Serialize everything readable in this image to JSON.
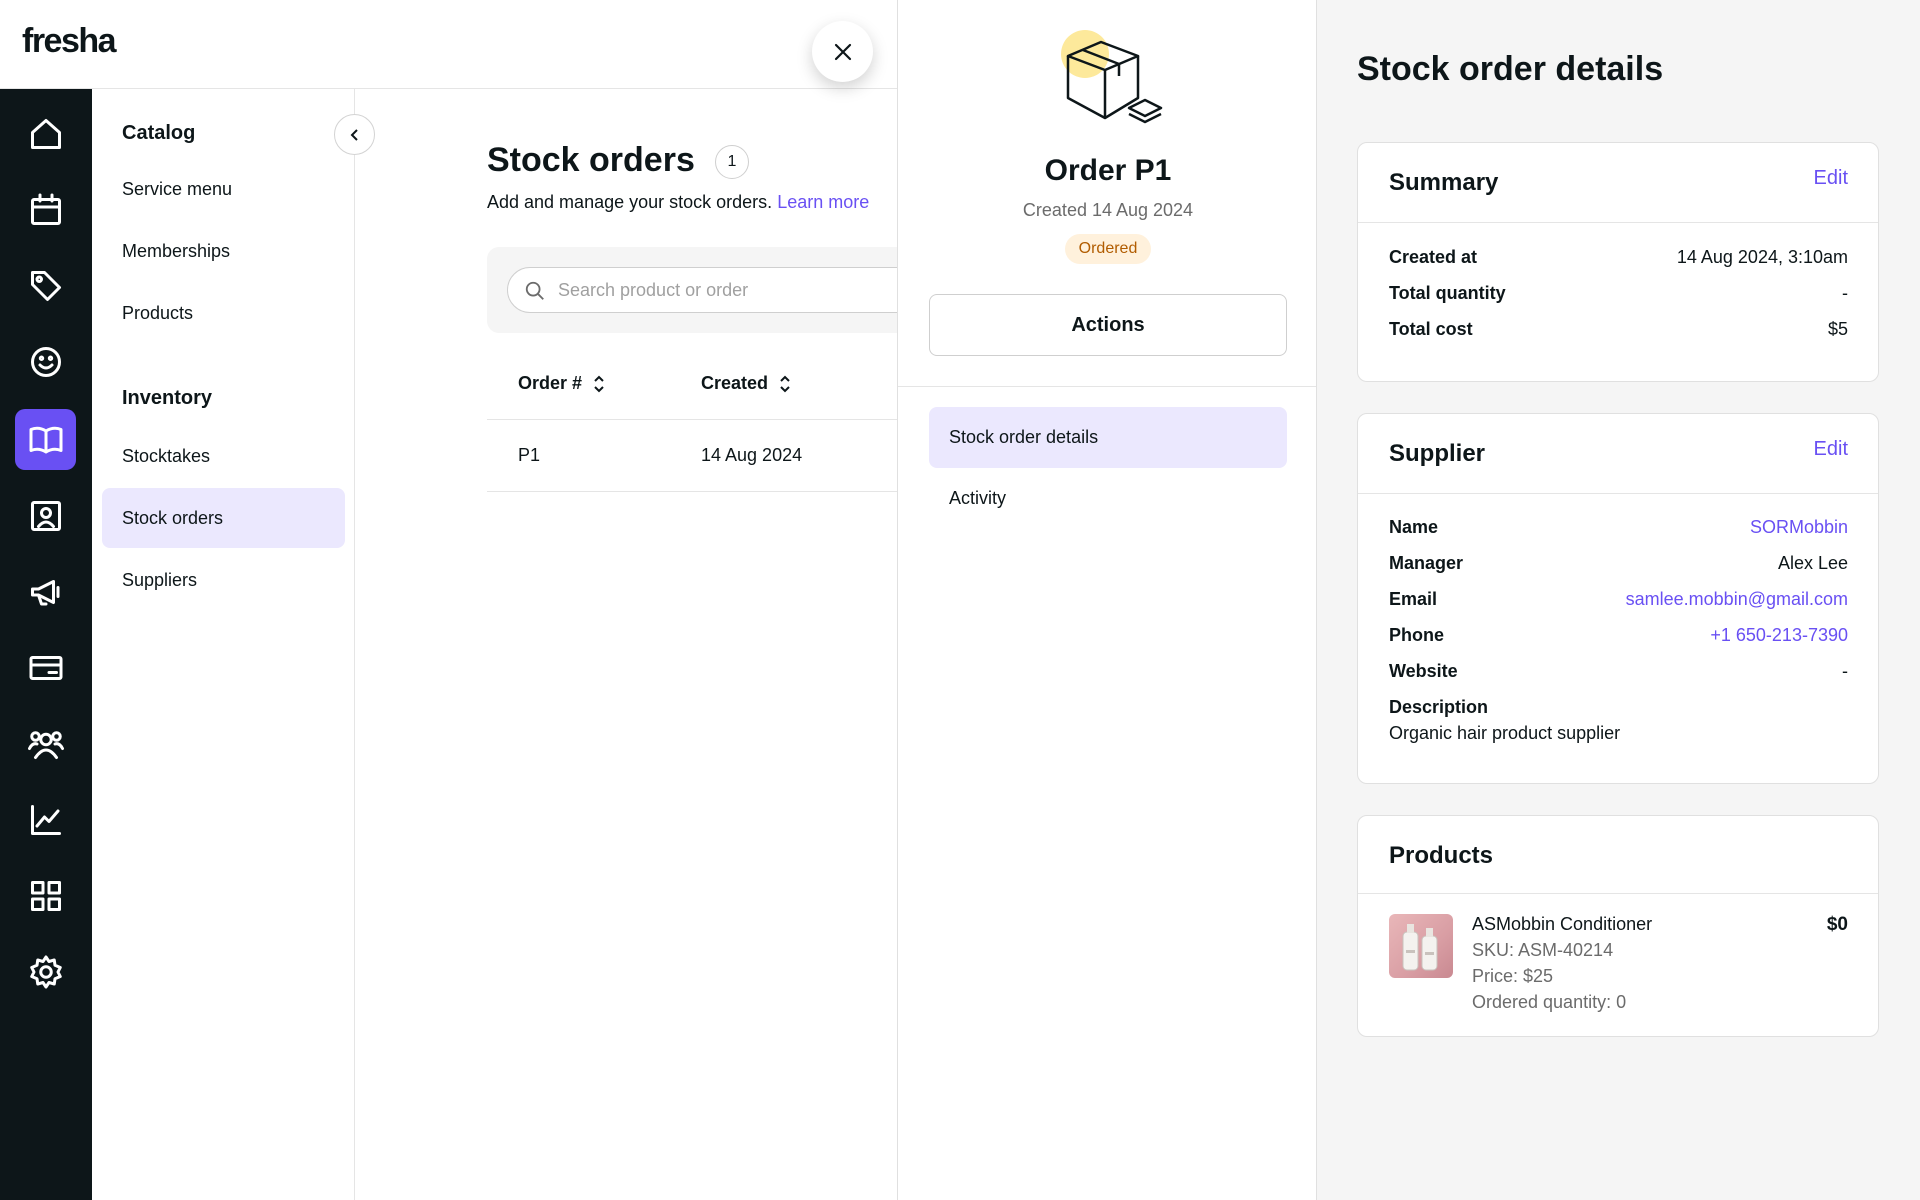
{
  "brand": {
    "logo": "fresha"
  },
  "rail": {
    "items": [
      {
        "icon": "home-icon"
      },
      {
        "icon": "calendar-icon"
      },
      {
        "icon": "tag-icon"
      },
      {
        "icon": "smiley-icon"
      },
      {
        "icon": "book-icon",
        "active": true
      },
      {
        "icon": "contact-card-icon"
      },
      {
        "icon": "megaphone-icon"
      },
      {
        "icon": "credit-card-icon"
      },
      {
        "icon": "team-icon"
      },
      {
        "icon": "chart-icon"
      },
      {
        "icon": "apps-grid-icon"
      },
      {
        "icon": "gear-icon"
      }
    ]
  },
  "catalog": {
    "heading": "Catalog",
    "items": [
      "Service menu",
      "Memberships",
      "Products"
    ],
    "inventory_heading": "Inventory",
    "inventory_items": [
      "Stocktakes",
      "Stock orders",
      "Suppliers"
    ],
    "active_item": "Stock orders"
  },
  "main": {
    "title": "Stock orders",
    "count": "1",
    "subtitle": "Add and manage your stock orders.",
    "learn_more": "Learn more",
    "search_placeholder": "Search product or order",
    "columns": [
      "Order #",
      "Created"
    ],
    "rows": [
      {
        "order": "P1",
        "created": "14 Aug 2024"
      }
    ]
  },
  "order": {
    "title": "Order P1",
    "created": "Created 14 Aug 2024",
    "status": "Ordered",
    "actions_label": "Actions",
    "nav": [
      "Stock order details",
      "Activity"
    ],
    "active_nav": "Stock order details"
  },
  "details": {
    "title": "Stock order details",
    "summary": {
      "title": "Summary",
      "edit": "Edit",
      "created_at_label": "Created at",
      "created_at": "14 Aug 2024, 3:10am",
      "total_quantity_label": "Total quantity",
      "total_quantity": "-",
      "total_cost_label": "Total cost",
      "total_cost": "$5"
    },
    "supplier": {
      "title": "Supplier",
      "edit": "Edit",
      "name_label": "Name",
      "name": "SORMobbin",
      "manager_label": "Manager",
      "manager": "Alex Lee",
      "email_label": "Email",
      "email": "samlee.mobbin@gmail.com",
      "phone_label": "Phone",
      "phone": "+1 650-213-7390",
      "website_label": "Website",
      "website": "-",
      "description_label": "Description",
      "description": "Organic hair product supplier"
    },
    "products": {
      "title": "Products",
      "items": [
        {
          "name": "ASMobbin Conditioner",
          "sku": "SKU: ASM-40214",
          "price": "Price: $25",
          "ordered": "Ordered quantity: 0",
          "total": "$0"
        }
      ]
    }
  },
  "colors": {
    "accent": "#6950f3",
    "rail_bg": "#0d1619",
    "active_bg": "#ebe8fe",
    "status_bg": "#fff1dc",
    "status_fg": "#b15c00"
  }
}
